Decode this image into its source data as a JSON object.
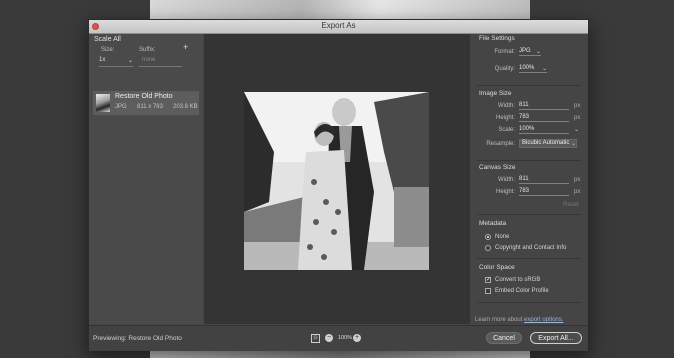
{
  "dialog": {
    "title": "Export As"
  },
  "left": {
    "scale_all": "Scale All",
    "size_label": "Size:",
    "suffix_label": "Suffix:",
    "size_value": "1x",
    "suffix_placeholder": "none",
    "add_icon": "plus-icon",
    "asset": {
      "name": "Restore Old Photo",
      "format": "JPG",
      "dimensions": "811 x 783",
      "filesize": "203.8 KB"
    }
  },
  "file_settings": {
    "title": "File Settings",
    "format_label": "Format:",
    "format_value": "JPG",
    "quality_label": "Quality:",
    "quality_value": "100%"
  },
  "image_size": {
    "title": "Image Size",
    "width_label": "Width:",
    "width_value": "811",
    "height_label": "Height:",
    "height_value": "783",
    "scale_label": "Scale:",
    "scale_value": "100%",
    "resample_label": "Resample:",
    "resample_value": "Bicubic Automatic",
    "unit": "px"
  },
  "canvas_size": {
    "title": "Canvas Size",
    "width_label": "Width:",
    "width_value": "811",
    "height_label": "Height:",
    "height_value": "783",
    "unit": "px",
    "reset_label": "Reset"
  },
  "metadata": {
    "title": "Metadata",
    "options": [
      "None",
      "Copyright and Contact Info"
    ],
    "selected": "None"
  },
  "color_space": {
    "title": "Color Space",
    "convert_label": "Convert to sRGB",
    "convert_checked": true,
    "embed_label": "Embed Color Profile",
    "embed_checked": false
  },
  "footer": {
    "learn_prefix": "Learn more about",
    "learn_link": "export options.",
    "previewing": "Previewing:  Restore Old Photo",
    "zoom": "100%",
    "cancel_label": "Cancel",
    "export_label": "Export All..."
  }
}
